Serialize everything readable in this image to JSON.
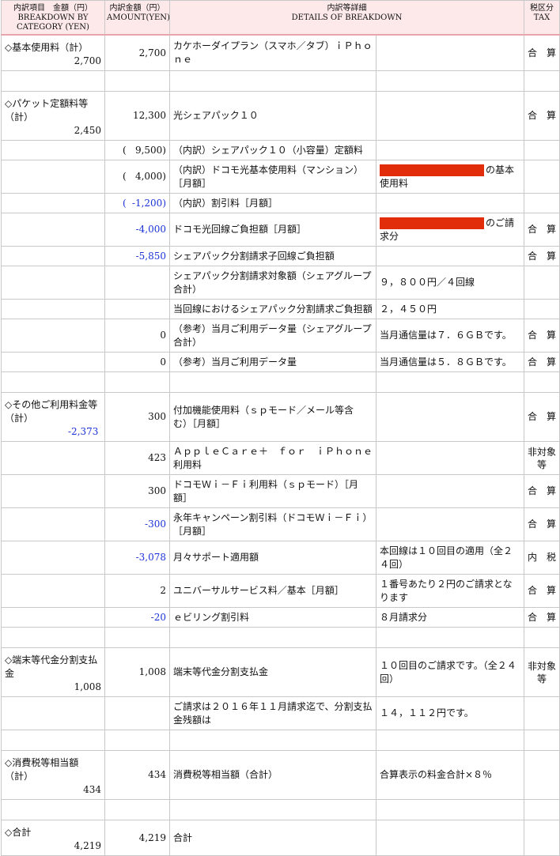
{
  "headers": {
    "category_ja": "内訳項目　金額（円）",
    "category_en1": "BREAKDOWN BY",
    "category_en2": "CATEGORY (YEN)",
    "amount_ja": "内訳金額（円）",
    "amount_en": "AMOUNT(YEN)",
    "details_ja": "内訳等詳細",
    "details_en": "DETAILS OF BREAKDOWN",
    "tax_ja": "税区分",
    "tax_en": "TAX"
  },
  "basic": {
    "cat": "◇基本使用料（計）",
    "cat_total": "2,700",
    "amount": "2,700",
    "label": "カケホーダイプラン（スマホ／タブ）ｉＰｈｏｎｅ",
    "tax": "合　算"
  },
  "packet": {
    "cat": "◇パケット定額料等（計）",
    "cat_total": "2,450",
    "r1": {
      "amount": "12,300",
      "label": "光シェアパック１０",
      "tax": "合　算"
    },
    "r2": {
      "open": "(",
      "amount": "9,500)",
      "label": "（内訳）シェアパック１０（小容量）定額料"
    },
    "r3": {
      "open": "(",
      "amount": "4,000)",
      "label": "（内訳）ドコモ光基本使用料（マンション）［月額］",
      "detail": "の基本使用料"
    },
    "r4": {
      "open": "(",
      "amount": "-1,200)",
      "label": "（内訳）割引料［月額］"
    },
    "r5": {
      "amount": "-4,000",
      "label": "ドコモ光回線ご負担額［月額］",
      "detail": "のご請求分",
      "tax": "合　算"
    },
    "r6": {
      "amount": "-5,850",
      "label": "シェアパック分割請求子回線ご負担額",
      "tax": "合　算"
    },
    "r7": {
      "label": "シェアパック分割請求対象額（シェアグループ合計）",
      "detail": "９，８００円／４回線"
    },
    "r8": {
      "label": "当回線におけるシェアパック分割請求ご負担額",
      "detail": "２，４５０円"
    },
    "r9": {
      "amount": "0",
      "label": "（参考）当月ご利用データ量（シェアグループ合計）",
      "detail": "当月通信量は７．６ＧＢです。",
      "tax": "合　算"
    },
    "r10": {
      "amount": "0",
      "label": "（参考）当月ご利用データ量",
      "detail": "当月通信量は５．８ＧＢです。",
      "tax": "合　算"
    }
  },
  "other": {
    "cat": "◇その他ご利用料金等（計）",
    "cat_total": "-2,373",
    "r1": {
      "amount": "300",
      "label": "付加機能使用料（ｓｐモード／メール等含む）［月額］",
      "tax": "合　算"
    },
    "r2": {
      "amount": "423",
      "label": "ＡｐｐｌｅＣａｒｅ＋　ｆｏｒ　ｉＰｈｏｎｅ利用料",
      "tax": "非対象等"
    },
    "r3": {
      "amount": "300",
      "label": "ドコモＷｉ－Ｆｉ利用料（ｓｐモード）［月額］",
      "tax": "合　算"
    },
    "r4": {
      "amount": "-300",
      "label": "永年キャンペーン割引料（ドコモＷｉ－Ｆｉ）［月額］",
      "tax": "合　算"
    },
    "r5": {
      "amount": "-3,078",
      "label": "月々サポート適用額",
      "detail": "本回線は１０回目の適用（全２４回）",
      "tax": "内　税"
    },
    "r6": {
      "amount": "2",
      "label": "ユニバーサルサービス料／基本［月額］",
      "detail": "１番号あたり２円のご請求となります",
      "tax": "合　算"
    },
    "r7": {
      "amount": "-20",
      "label": "ｅビリング割引料",
      "detail": "８月請求分",
      "tax": "合　算"
    }
  },
  "device": {
    "cat": "◇端末等代金分割支払金",
    "cat_total": "1,008",
    "r1": {
      "amount": "1,008",
      "label": "端末等代金分割支払金",
      "detail": "１０回目のご請求です。（全２４回）",
      "tax": "非対象等"
    },
    "r2": {
      "label": "ご請求は２０１６年１１月請求迄で、分割支払金残額は",
      "detail": "１４，１１２円です。"
    }
  },
  "ctax": {
    "cat": "◇消費税等相当額（計）",
    "cat_total": "434",
    "r1": {
      "amount": "434",
      "label": "消費税等相当額（合計）",
      "detail": "合算表示の料金合計×８％"
    }
  },
  "total": {
    "cat": "◇合計",
    "cat_total": "4,219",
    "amount": "4,219",
    "label": "合計"
  },
  "colors": {
    "header_bg": "#fde9ea",
    "header_rule": "#e8a5ac",
    "negative": "#1a32d8",
    "redaction": "#e22d0b",
    "border": "#c8c8c8"
  }
}
